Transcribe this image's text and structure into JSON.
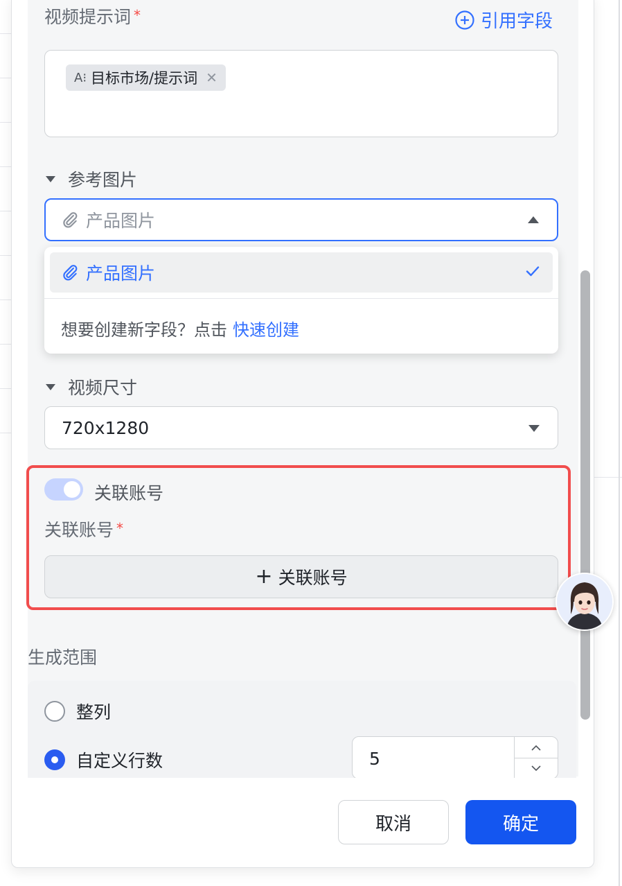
{
  "form": {
    "video_prompt": {
      "label": "视频提示词",
      "required_mark": "*",
      "cite_field_label": "引用字段",
      "chip_label": "目标市场/提示词",
      "chip_icon": "A⁝",
      "chip_remove": "✕"
    },
    "reference_image": {
      "section_label": "参考图片",
      "placeholder": "产品图片",
      "dropdown": {
        "option_label": "产品图片",
        "option_selected": true,
        "hint_text": "想要创建新字段？点击",
        "hint_link": "快速创建"
      }
    },
    "video_size": {
      "section_label": "视频尺寸",
      "value": "720x1280"
    },
    "linked_account": {
      "toggle_label": "关联账号",
      "toggle_on": true,
      "field_label": "关联账号",
      "required_mark": "*",
      "add_button_label": "关联账号",
      "add_button_icon": "+"
    },
    "generation_range": {
      "label": "生成范围",
      "options": [
        {
          "label": "整列",
          "selected": false
        },
        {
          "label": "自定义行数",
          "selected": true
        }
      ],
      "row_count": "5"
    }
  },
  "footer": {
    "cancel_label": "取消",
    "confirm_label": "确定"
  },
  "colors": {
    "accent": "#3370ff",
    "primary_button": "#1456f0",
    "highlight_border": "#f14d4d",
    "required": "#f54a45"
  }
}
